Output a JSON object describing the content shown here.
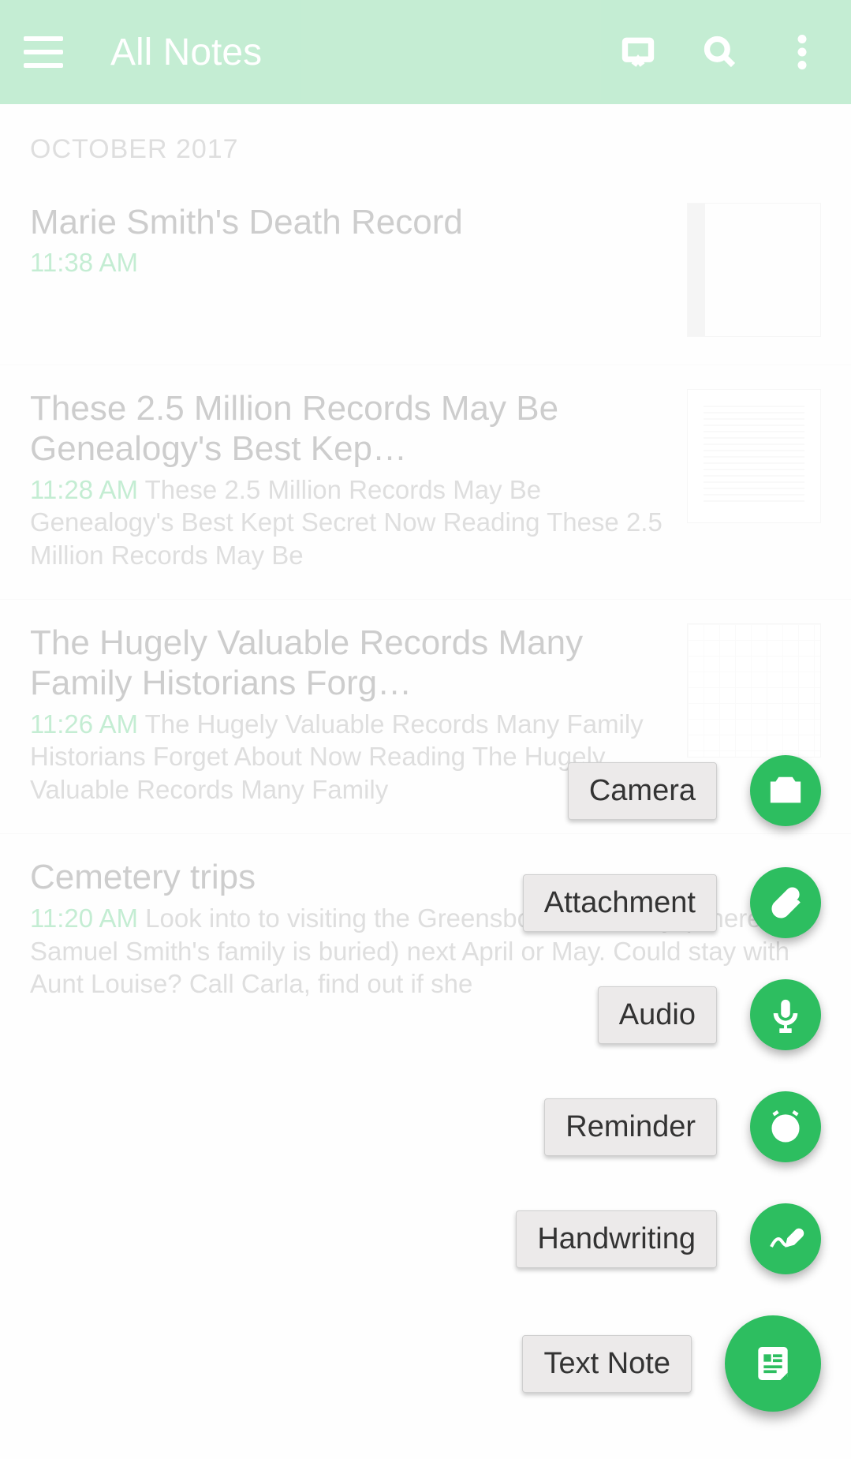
{
  "header": {
    "title": "All Notes",
    "menu_icon": "menu-icon",
    "presentation_icon": "presentation-icon",
    "search_icon": "search-icon",
    "overflow_icon": "more-vertical-icon"
  },
  "section_header": "OCTOBER 2017",
  "notes": [
    {
      "title": "Marie Smith's Death Record",
      "time": "11:38 AM",
      "snippet": "",
      "thumb": "spine"
    },
    {
      "title": "These 2.5 Million Records May Be Genealogy's Best Kep…",
      "time": "11:28 AM",
      "snippet": "These 2.5 Million Records May Be Genealogy's Best Kept Secret Now Reading These 2.5 Million Records May Be",
      "thumb": "doc"
    },
    {
      "title": "The Hugely Valuable Records Many Family Historians Forg…",
      "time": "11:26 AM",
      "snippet": "The Hugely Valuable Records Many Family Historians Forget About Now Reading The Hugely Valuable Records Many Family",
      "thumb": "grid"
    },
    {
      "title": "Cemetery trips",
      "time": "11:20 AM",
      "snippet": "Look into to visiting the Greensboro Cemetery (where Samuel Smith's family is buried) next April or May. Could stay with Aunt Louise?  Call Carla, find out if she",
      "thumb": ""
    }
  ],
  "fab_items": [
    {
      "label": "Camera",
      "icon": "camera-icon"
    },
    {
      "label": "Attachment",
      "icon": "attachment-icon"
    },
    {
      "label": "Audio",
      "icon": "microphone-icon"
    },
    {
      "label": "Reminder",
      "icon": "alarm-icon"
    },
    {
      "label": "Handwriting",
      "icon": "handwriting-icon"
    }
  ],
  "fab_main": {
    "label": "Text Note",
    "icon": "text-note-icon"
  },
  "colors": {
    "accent": "#2dbe60"
  }
}
